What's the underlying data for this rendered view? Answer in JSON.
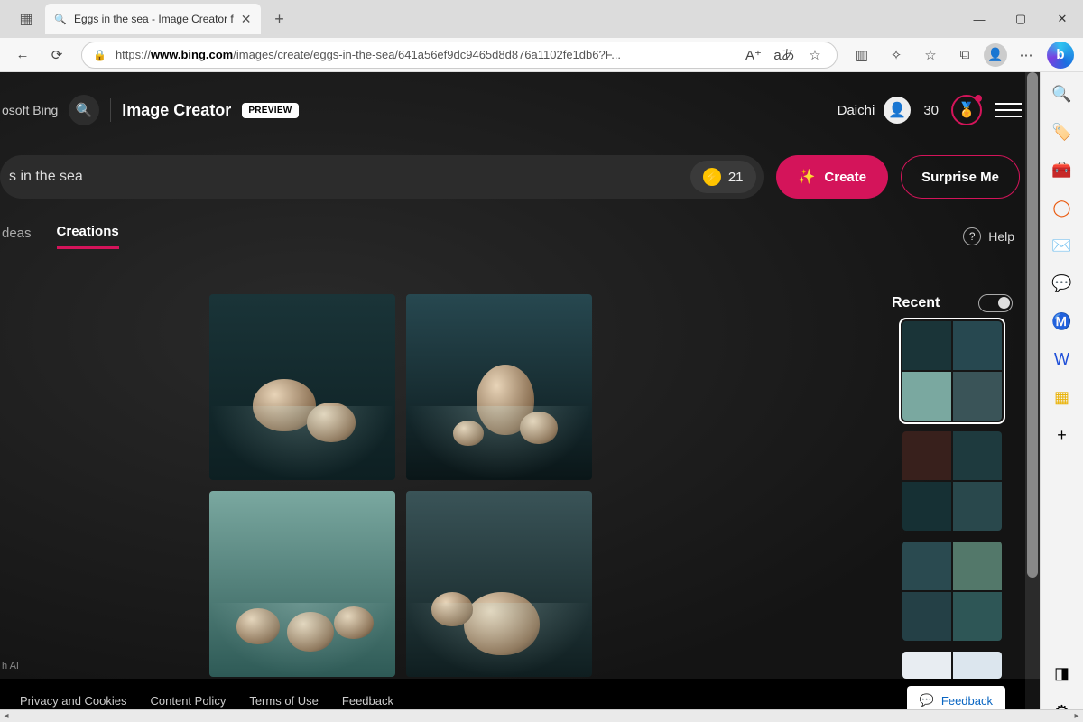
{
  "browser": {
    "tab_title": "Eggs in the sea - Image Creator f",
    "url_display_prefix": "https://",
    "url_display_host": "www.bing.com",
    "url_display_path": "/images/create/eggs-in-the-sea/641a56ef9dc9465d8d876a1102fe1db6?F...",
    "win_min": "—",
    "win_max": "▢",
    "win_close": "✕"
  },
  "header": {
    "brand": "osoft Bing",
    "product": "Image Creator",
    "badge": "PREVIEW",
    "user_name": "Daichi",
    "points": "30"
  },
  "prompt": {
    "value": "s in the sea",
    "boosts": "21",
    "create_label": "Create",
    "surprise_label": "Surprise Me"
  },
  "tabs": {
    "ideas": "deas",
    "creations": "Creations",
    "help": "Help"
  },
  "recent": {
    "title": "Recent"
  },
  "footer": {
    "privacy": "Privacy and Cookies",
    "content": "Content Policy",
    "terms": "Terms of Use",
    "feedback_link": "Feedback",
    "feedback_btn": "Feedback",
    "ai_note": "h AI"
  },
  "colors": {
    "accent": "#d4145a"
  }
}
